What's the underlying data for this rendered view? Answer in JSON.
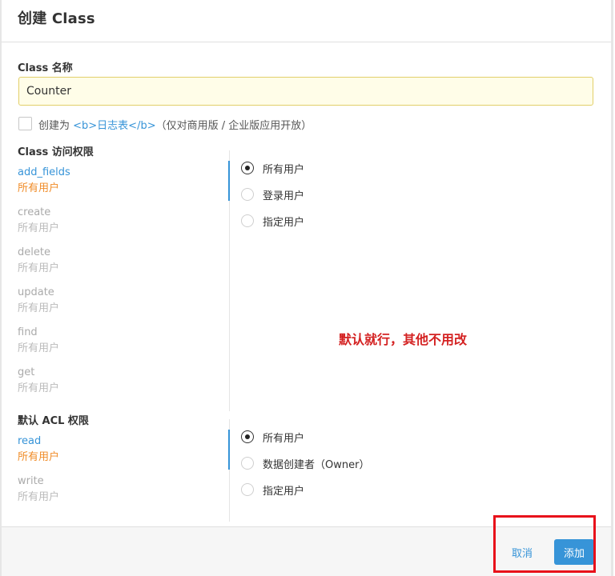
{
  "dialog": {
    "title": "创建 Class"
  },
  "name_field": {
    "label": "Class 名称",
    "value": "Counter"
  },
  "log_option": {
    "prefix": "创建为 ",
    "link": "<b>日志表</b>",
    "suffix": "（仅对商用版 / 企业版应用开放）",
    "checked": false
  },
  "class_access": {
    "title": "Class 访问权限",
    "operations": [
      {
        "name": "add_fields",
        "value": "所有用户",
        "active": true
      },
      {
        "name": "create",
        "value": "所有用户",
        "active": false
      },
      {
        "name": "delete",
        "value": "所有用户",
        "active": false
      },
      {
        "name": "update",
        "value": "所有用户",
        "active": false
      },
      {
        "name": "find",
        "value": "所有用户",
        "active": false
      },
      {
        "name": "get",
        "value": "所有用户",
        "active": false
      }
    ],
    "options": [
      "所有用户",
      "登录用户",
      "指定用户"
    ],
    "selected": "所有用户"
  },
  "annotation": "默认就行，其他不用改",
  "default_acl": {
    "title": "默认 ACL 权限",
    "operations": [
      {
        "name": "read",
        "value": "所有用户",
        "active": true
      },
      {
        "name": "write",
        "value": "所有用户",
        "active": false
      }
    ],
    "options": [
      "所有用户",
      "数据创建者（Owner）",
      "指定用户"
    ],
    "selected": "所有用户"
  },
  "footer": {
    "cancel_label": "取消",
    "add_label": "添加"
  },
  "colors": {
    "accent": "#3794d8",
    "active_value": "#f08c28",
    "annotation": "#d42222",
    "highlight_box": "#e8101a",
    "input_bg": "#fffde8"
  }
}
